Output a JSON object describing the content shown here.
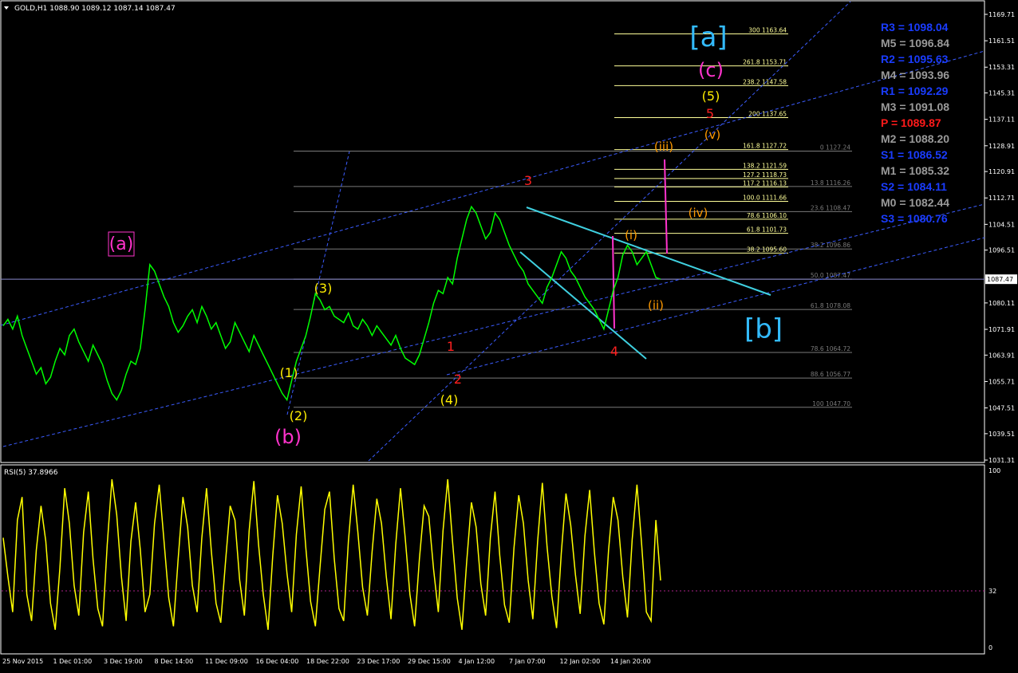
{
  "window": {
    "symbol_header": "GOLD,H1  1088.90 1089.12 1087.14 1087.47",
    "current_price_label": "1087.47"
  },
  "colors": {
    "background": "#000000",
    "price_series": "#00ff00",
    "rsi_series": "#ffff00",
    "grid_axis": "#ffffff",
    "trendline_dashed": "#3b5cff",
    "triangle_lines": "#3fd0e0",
    "fib_fan_lines": "#ffff99",
    "fib_retrace_gray": "#7a7a7a",
    "wave_yellow": "#ffee00",
    "wave_magenta": "#ff33cc",
    "wave_red": "#ff2020",
    "wave_orange": "#ff9900",
    "wave_cyan": "#33bbff"
  },
  "chart_data": [
    {
      "type": "line",
      "panel": "price",
      "ylim": [
        1031.31,
        1169.71
      ],
      "y_ticks": [
        "1169.71",
        "1161.51",
        "1153.31",
        "1145.31",
        "1137.11",
        "1128.91",
        "1120.91",
        "1112.71",
        "1104.51",
        "1096.51",
        "1080.11",
        "1071.91",
        "1063.91",
        "1055.71",
        "1047.51",
        "1039.51",
        "1031.31"
      ],
      "x_tick_labels": [
        "25 Nov 2015",
        "1 Dec 01:00",
        "3 Dec 19:00",
        "8 Dec 14:00",
        "11 Dec 09:00",
        "16 Dec 04:00",
        "18 Dec 22:00",
        "23 Dec 17:00",
        "29 Dec 15:00",
        "4 Jan 12:00",
        "7 Jan 07:00",
        "12 Jan 02:00",
        "14 Jan 20:00"
      ],
      "series": [
        {
          "values": [
            1073,
            1075,
            1072,
            1076,
            1070,
            1066,
            1062,
            1058,
            1060,
            1055,
            1057,
            1062,
            1066,
            1064,
            1070,
            1072,
            1068,
            1065,
            1062,
            1067,
            1064,
            1061,
            1056,
            1052,
            1050,
            1053,
            1058,
            1062,
            1061,
            1066,
            1078,
            1092,
            1090,
            1086,
            1082,
            1079,
            1074,
            1071,
            1073,
            1076,
            1078,
            1074,
            1079,
            1076,
            1072,
            1074,
            1070,
            1066,
            1068,
            1074,
            1071,
            1068,
            1065,
            1070,
            1067,
            1064,
            1061,
            1058,
            1055,
            1052,
            1050,
            1056,
            1062,
            1066,
            1070,
            1076,
            1083,
            1081,
            1078,
            1079,
            1076,
            1075,
            1074,
            1077,
            1073,
            1072,
            1075,
            1073,
            1070,
            1073,
            1071,
            1069,
            1067,
            1070,
            1066,
            1063,
            1062,
            1061,
            1064,
            1069,
            1074,
            1080,
            1084,
            1083,
            1088,
            1086,
            1094,
            1100,
            1106,
            1110,
            1108,
            1104,
            1100,
            1102,
            1108,
            1106,
            1102,
            1098,
            1095,
            1092,
            1090,
            1086,
            1084,
            1082,
            1080,
            1085,
            1088,
            1092,
            1096,
            1094,
            1090,
            1088,
            1085,
            1082,
            1080,
            1078,
            1075,
            1072,
            1078,
            1084,
            1088,
            1095,
            1098,
            1096,
            1092,
            1094,
            1096,
            1092,
            1088,
            1087.47
          ]
        }
      ],
      "fib_extension_levels": [
        {
          "ratio": "300",
          "price": "1163.64"
        },
        {
          "ratio": "261.8",
          "price": "1153.71"
        },
        {
          "ratio": "238.2",
          "price": "1147.58"
        },
        {
          "ratio": "200",
          "price": "1137.65"
        },
        {
          "ratio": "161.8",
          "price": "1127.72"
        },
        {
          "ratio": "138.2",
          "price": "1121.59"
        },
        {
          "ratio": "127.2",
          "price": "1118.73"
        },
        {
          "ratio": "117.2",
          "price": "1116.13"
        },
        {
          "ratio": "100.0",
          "price": "1111.66"
        },
        {
          "ratio": "78.6",
          "price": "1106.10"
        },
        {
          "ratio": "61.8",
          "price": "1101.73"
        },
        {
          "ratio": "38.2",
          "price": "1095.60"
        }
      ],
      "fib_retracement_levels": [
        {
          "ratio": "0",
          "price": "1127.24"
        },
        {
          "ratio": "13.8",
          "price": "1116.26"
        },
        {
          "ratio": "23.6",
          "price": "1108.47"
        },
        {
          "ratio": "38.2",
          "price": "1096.86"
        },
        {
          "ratio": "50.0",
          "price": "1087.47"
        },
        {
          "ratio": "61.8",
          "price": "1078.08"
        },
        {
          "ratio": "78.6",
          "price": "1064.72"
        },
        {
          "ratio": "88.6",
          "price": "1056.77"
        },
        {
          "ratio": "100",
          "price": "1047.70"
        }
      ],
      "wave_labels": [
        {
          "text": "(a)",
          "color": "magenta",
          "boxed": true
        },
        {
          "text": "(b)",
          "color": "magenta"
        },
        {
          "text": "(c)",
          "color": "magenta"
        },
        {
          "text": "(1)",
          "color": "yellow"
        },
        {
          "text": "(2)",
          "color": "yellow"
        },
        {
          "text": "(3)",
          "color": "yellow"
        },
        {
          "text": "(4)",
          "color": "yellow"
        },
        {
          "text": "(5)",
          "color": "yellow"
        },
        {
          "text": "1",
          "color": "red"
        },
        {
          "text": "2",
          "color": "red"
        },
        {
          "text": "3",
          "color": "red"
        },
        {
          "text": "4",
          "color": "red"
        },
        {
          "text": "5",
          "color": "red"
        },
        {
          "text": "(i)",
          "color": "orange"
        },
        {
          "text": "(ii)",
          "color": "orange"
        },
        {
          "text": "(iii)",
          "color": "orange"
        },
        {
          "text": "(iv)",
          "color": "orange"
        },
        {
          "text": "(v)",
          "color": "orange"
        },
        {
          "text": "[a]",
          "color": "cyan"
        },
        {
          "text": "[b]",
          "color": "cyan"
        }
      ]
    },
    {
      "type": "line",
      "panel": "rsi",
      "title": "RSI(5) 37.8966",
      "ylim": [
        0,
        100
      ],
      "y_ticks": [
        "100",
        "32",
        "0"
      ],
      "levels": [
        32
      ],
      "series": [
        {
          "values": [
            62,
            40,
            20,
            72,
            85,
            30,
            15,
            55,
            80,
            60,
            25,
            10,
            45,
            90,
            70,
            35,
            18,
            65,
            88,
            50,
            22,
            12,
            58,
            95,
            75,
            40,
            15,
            60,
            82,
            55,
            20,
            30,
            70,
            92,
            60,
            28,
            12,
            50,
            85,
            68,
            35,
            20,
            62,
            90,
            55,
            25,
            14,
            48,
            80,
            72,
            38,
            18,
            66,
            94,
            58,
            30,
            10,
            52,
            86,
            70,
            42,
            20,
            64,
            91,
            56,
            26,
            12,
            46,
            78,
            88,
            50,
            22,
            15,
            60,
            92,
            65,
            34,
            18,
            54,
            84,
            70,
            40,
            16,
            58,
            90,
            62,
            30,
            12,
            50,
            80,
            74,
            44,
            20,
            66,
            95,
            60,
            28,
            10,
            48,
            82,
            68,
            36,
            18,
            62,
            88,
            52,
            24,
            14,
            56,
            86,
            70,
            38,
            16,
            60,
            93,
            57,
            29,
            11,
            53,
            87,
            69,
            41,
            19,
            63,
            89,
            54,
            25,
            13,
            55,
            85,
            72,
            40,
            17,
            61,
            92,
            58,
            20,
            15,
            72,
            37.9
          ]
        }
      ]
    }
  ],
  "pivot_levels": [
    {
      "label": "R3 = 1098.04",
      "color": "#1a3cff"
    },
    {
      "label": "M5 = 1096.84",
      "color": "#9a9a9a"
    },
    {
      "label": "R2 = 1095.63",
      "color": "#1a3cff"
    },
    {
      "label": "M4 = 1093.96",
      "color": "#9a9a9a"
    },
    {
      "label": "R1 = 1092.29",
      "color": "#1a3cff"
    },
    {
      "label": "M3 = 1091.08",
      "color": "#9a9a9a"
    },
    {
      "label": "P   = 1089.87",
      "color": "#ff1a1a"
    },
    {
      "label": "M2 = 1088.20",
      "color": "#9a9a9a"
    },
    {
      "label": "S1 = 1086.52",
      "color": "#1a3cff"
    },
    {
      "label": "M1 = 1085.32",
      "color": "#9a9a9a"
    },
    {
      "label": "S2 = 1084.11",
      "color": "#1a3cff"
    },
    {
      "label": "M0 = 1082.44",
      "color": "#9a9a9a"
    },
    {
      "label": "S3 = 1080.76",
      "color": "#1a3cff"
    }
  ]
}
